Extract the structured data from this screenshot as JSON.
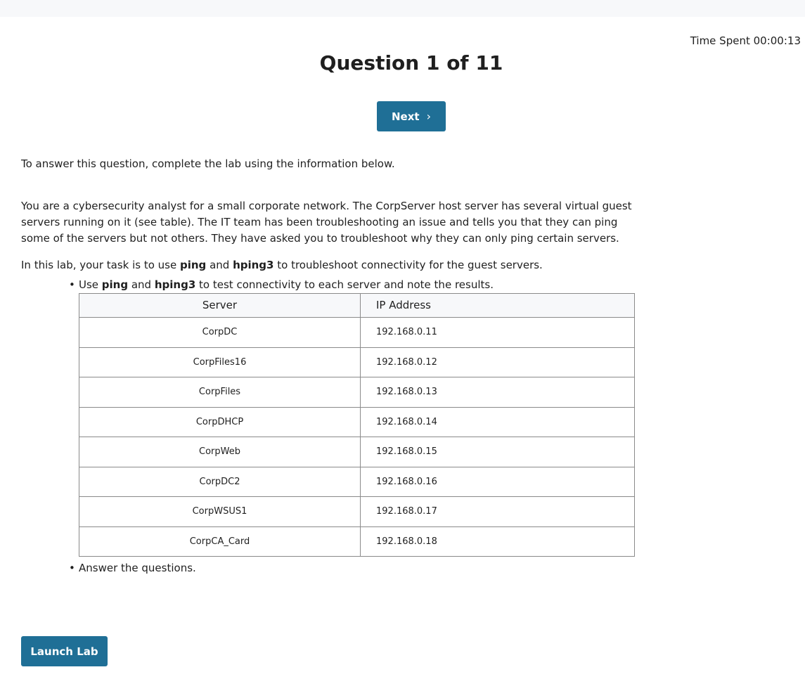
{
  "header": {
    "time_spent_label": "Time Spent",
    "time_spent_value": "00:00:13",
    "title": "Question 1 of 11",
    "next_label": "Next",
    "next_icon": "chevron-right-icon"
  },
  "content": {
    "intro": "To answer this question, complete the lab using the information below.",
    "scenario": "You are a cybersecurity analyst for a small corporate network. The CorpServer host server has several virtual guest servers running on it (see table). The IT team has been troubleshooting an issue and tells you that they can ping some of the servers but not others. They have asked you to troubleshoot why they can only ping certain servers.",
    "task": {
      "prefix": "In this lab, your task is to use ",
      "tool1": "ping",
      "and": " and ",
      "tool2": "hping3",
      "suffix": " to troubleshoot connectivity for the guest servers."
    },
    "bullet1": {
      "prefix": "Use ",
      "tool1": "ping",
      "and": " and ",
      "tool2": "hping3",
      "suffix": " to test connectivity to each server and note the results."
    },
    "bullet2": "Answer the questions."
  },
  "table": {
    "headers": [
      "Server",
      "IP Address"
    ],
    "rows": [
      {
        "server": "CorpDC",
        "ip": "192.168.0.11"
      },
      {
        "server": "CorpFiles16",
        "ip": "192.168.0.12"
      },
      {
        "server": "CorpFiles",
        "ip": "192.168.0.13"
      },
      {
        "server": "CorpDHCP",
        "ip": "192.168.0.14"
      },
      {
        "server": "CorpWeb",
        "ip": "192.168.0.15"
      },
      {
        "server": "CorpDC2",
        "ip": "192.168.0.16"
      },
      {
        "server": "CorpWSUS1",
        "ip": "192.168.0.17"
      },
      {
        "server": "CorpCA_Card",
        "ip": "192.168.0.18"
      }
    ]
  },
  "footer": {
    "launch_label": "Launch Lab"
  },
  "colors": {
    "button_bg": "#1f6f96",
    "header_bg": "#f7f8fa"
  }
}
